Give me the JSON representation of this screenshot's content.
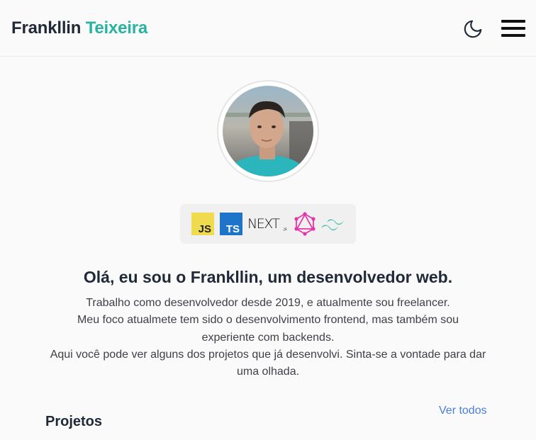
{
  "header": {
    "brand_first": "Frankllin",
    "brand_last": "Teixeira",
    "theme_toggle_icon": "moon-icon",
    "menu_icon": "hamburger-menu-icon",
    "brand_accent_color": "#2ab3a1"
  },
  "hero": {
    "avatar_alt": "Frankllin Teixeira",
    "tech_stack": [
      {
        "name": "JavaScript",
        "icon": "javascript-icon",
        "text": "JS"
      },
      {
        "name": "TypeScript",
        "icon": "typescript-icon",
        "text": "TS"
      },
      {
        "name": "Next.js",
        "icon": "nextjs-icon",
        "text": "NEXT",
        "suffix": ".JS"
      },
      {
        "name": "GraphQL",
        "icon": "graphql-icon"
      },
      {
        "name": "Tailwind CSS",
        "icon": "tailwind-icon"
      }
    ],
    "headline": "Olá, eu sou o Frankllin, um desenvolvedor web.",
    "bio_lines": [
      "Trabalho como desenvolvedor desde 2019, e atualmente sou freelancer.",
      "Meu foco atualmete tem sido o desenvolvimento frontend, mas também sou experiente com backends.",
      "Aqui você pode ver alguns dos projetos que já desenvolvi. Sinta-se a vontade para dar uma olhada."
    ]
  },
  "projects": {
    "title": "Projetos",
    "see_all_label": "Ver todos",
    "link_color": "#4a7fdb"
  }
}
